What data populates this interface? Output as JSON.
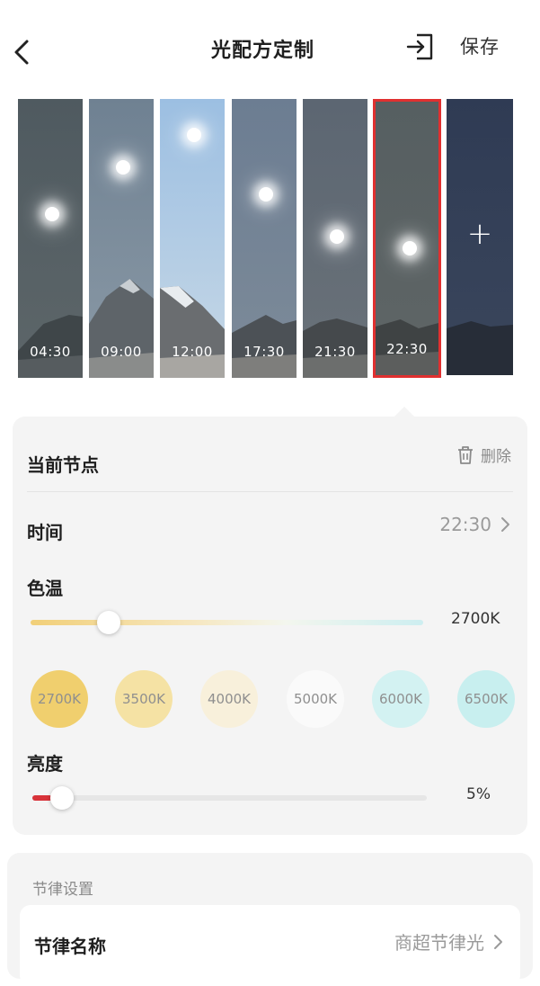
{
  "header": {
    "title": "光配方定制",
    "save_label": "保存"
  },
  "timeline": {
    "nodes": [
      {
        "time": "04:30"
      },
      {
        "time": "09:00"
      },
      {
        "time": "12:00"
      },
      {
        "time": "17:30"
      },
      {
        "time": "21:30"
      },
      {
        "time": "22:30",
        "selected": true
      }
    ],
    "add_label": "+"
  },
  "current_node": {
    "title": "当前节点",
    "delete_label": "删除",
    "time_label": "时间",
    "time_value": "22:30",
    "color_temp": {
      "label": "色温",
      "value": "2700K",
      "level": 0.2,
      "presets": [
        {
          "label": "2700K",
          "color": "#f0cf6e"
        },
        {
          "label": "3500K",
          "color": "#f5e2a4"
        },
        {
          "label": "4000K",
          "color": "#f8f0db"
        },
        {
          "label": "5000K",
          "color": "#fafafa"
        },
        {
          "label": "6000K",
          "color": "#d3f2f2"
        },
        {
          "label": "6500K",
          "color": "#c8efef"
        }
      ]
    },
    "brightness": {
      "label": "亮度",
      "value": "5%",
      "level": 0.05,
      "accent": "#d8333a"
    }
  },
  "rhythm": {
    "title": "节律设置",
    "name_label": "节律名称",
    "name_value": "商超节律光"
  }
}
